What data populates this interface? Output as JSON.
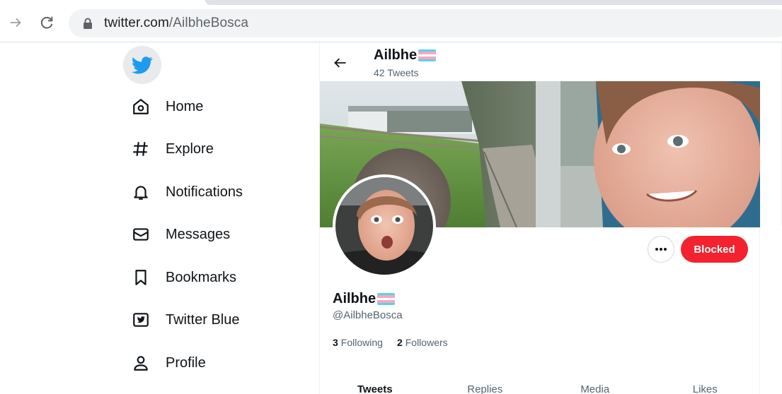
{
  "browser": {
    "url_host": "twitter.com",
    "url_path": "/AilbheBosca"
  },
  "sidebar": {
    "items": [
      {
        "label": "Home",
        "icon": "home-icon"
      },
      {
        "label": "Explore",
        "icon": "hashtag-icon"
      },
      {
        "label": "Notifications",
        "icon": "bell-icon"
      },
      {
        "label": "Messages",
        "icon": "envelope-icon"
      },
      {
        "label": "Bookmarks",
        "icon": "bookmark-icon"
      },
      {
        "label": "Twitter Blue",
        "icon": "twitter-blue-icon"
      },
      {
        "label": "Profile",
        "icon": "person-icon"
      }
    ]
  },
  "header": {
    "name": "Ailbhe",
    "tweet_count": "42 Tweets"
  },
  "profile": {
    "display_name": "Ailbhe",
    "handle": "@AilbheBosca",
    "following_count": "3",
    "following_label": "Following",
    "followers_count": "2",
    "followers_label": "Followers",
    "blocked_label": "Blocked"
  },
  "tabs": [
    {
      "label": "Tweets",
      "active": true
    },
    {
      "label": "Replies",
      "active": false
    },
    {
      "label": "Media",
      "active": false
    },
    {
      "label": "Likes",
      "active": false
    }
  ],
  "colors": {
    "twitter_blue": "#1d9bf0",
    "blocked_red": "#f4212e",
    "flag_blue": "#5bcefa",
    "flag_pink": "#f5a9b8"
  }
}
